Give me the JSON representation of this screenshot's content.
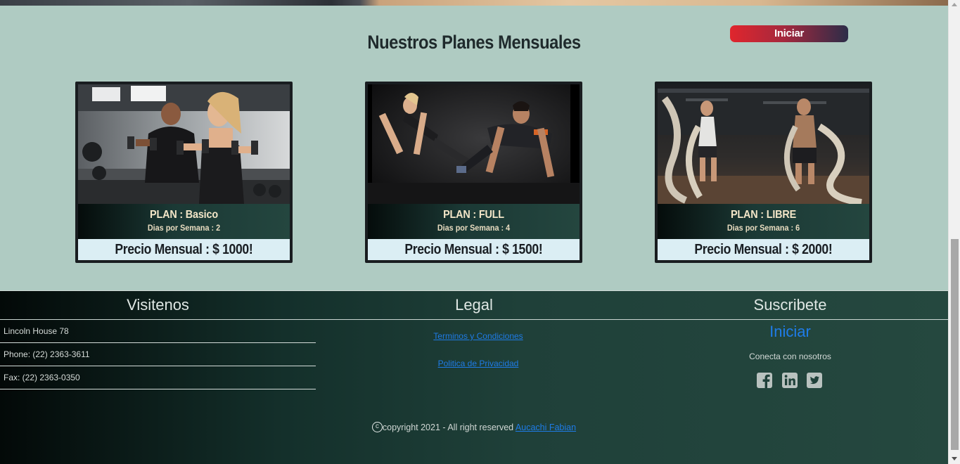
{
  "header": {
    "cta_label": "Iniciar"
  },
  "plans_section": {
    "title": "Nuestros Planes Mensuales",
    "plans": [
      {
        "name": "PLAN : Basico",
        "days": "Dias por Semana : 2",
        "price": "Precio Mensual : $ 1000!"
      },
      {
        "name": "PLAN : FULL",
        "days": "Dias por Semana : 4",
        "price": "Precio Mensual : $ 1500!"
      },
      {
        "name": "PLAN : LIBRE",
        "days": "Dias por Semana : 6",
        "price": "Precio Mensual : $ 2000!"
      }
    ]
  },
  "footer": {
    "visit": {
      "title": "Visitenos",
      "items": [
        "Lincoln House 78",
        "Phone: (22) 2363-3611",
        "Fax: (22) 2363-0350"
      ]
    },
    "legal": {
      "title": "Legal",
      "links": [
        "Terminos y Condiciones",
        "Politica de Privacidad"
      ]
    },
    "subscribe": {
      "title": "Suscribete",
      "link": "Iniciar",
      "text": "Conecta con nosotros",
      "social_icons": [
        "facebook-icon",
        "linkedin-icon",
        "twitter-icon"
      ]
    },
    "copyright": {
      "symbol": "c",
      "text": "copyright 2021 - All right reserved ",
      "author": "Aucachi Fabian"
    }
  },
  "colors": {
    "page_bg": "#afcbc2",
    "link": "#1e7be6",
    "cta_start": "#e0262d",
    "cta_end": "#2c2c48",
    "footer_dark": "#030908",
    "footer_green": "#25483f"
  }
}
